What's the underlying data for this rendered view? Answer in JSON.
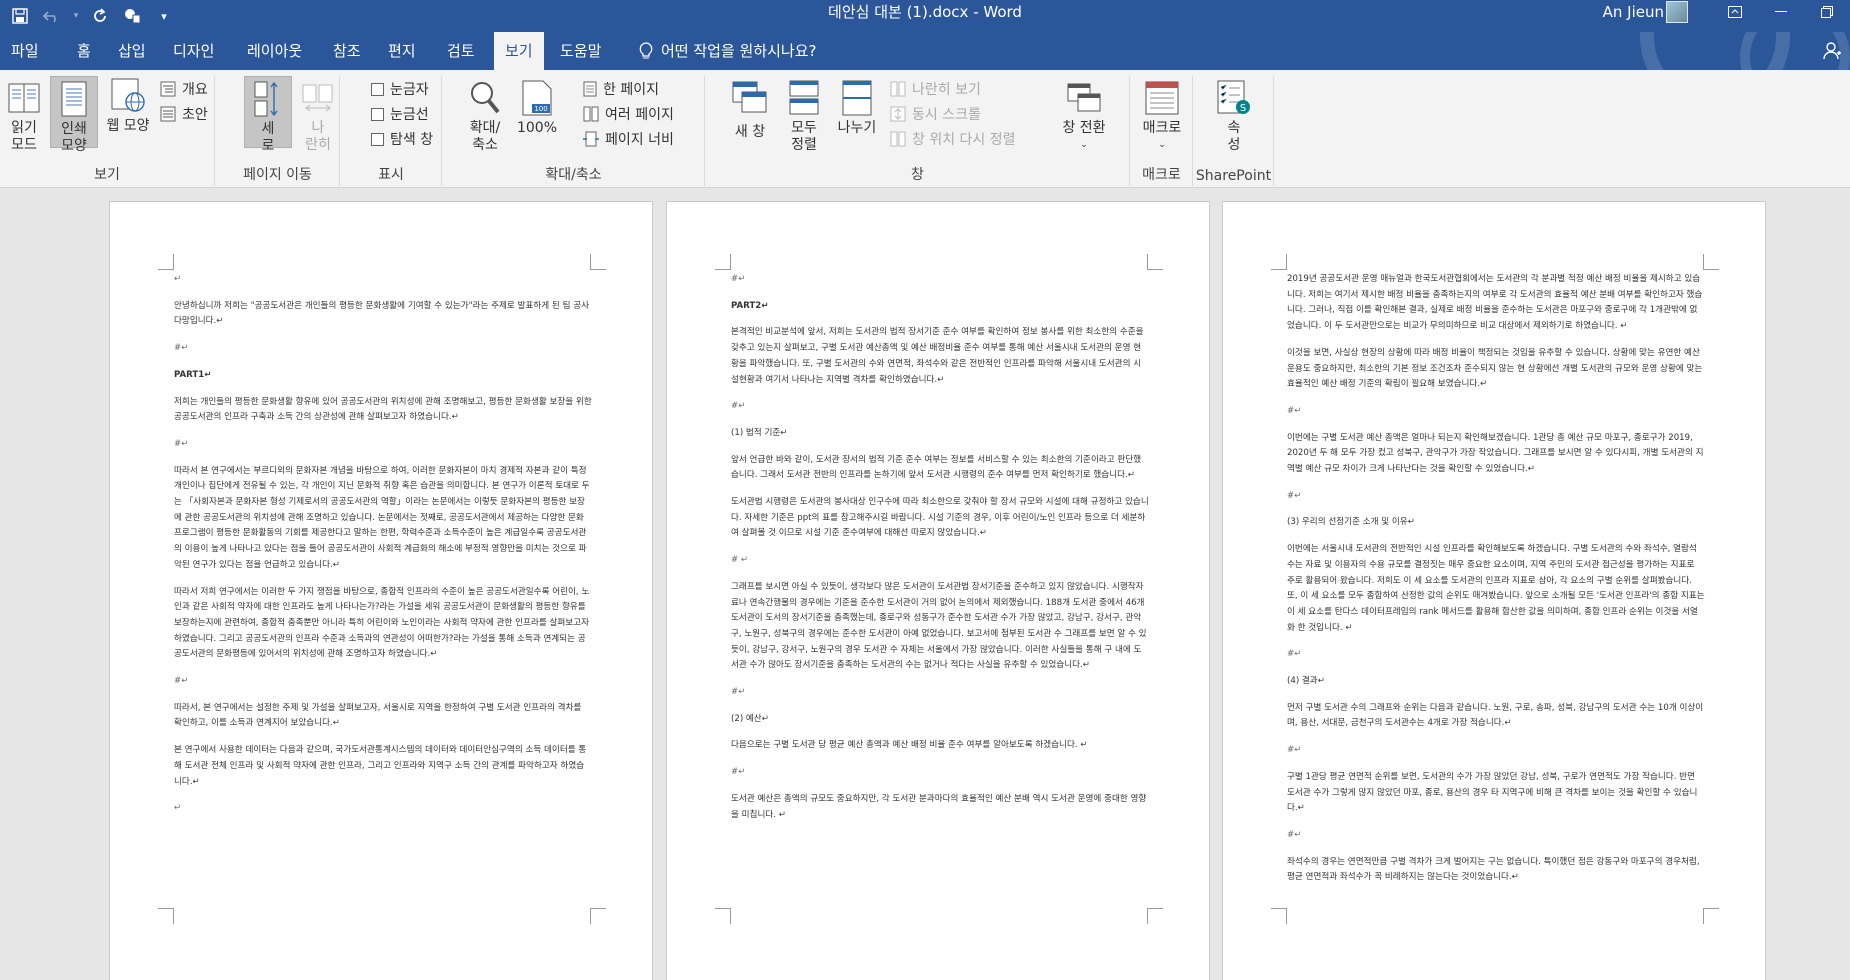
{
  "window": {
    "doc_title": "데안심 대본 (1).docx  -  Word",
    "user_name": "An Jieun",
    "qat": [
      {
        "icon": "save-icon"
      },
      {
        "icon": "undo-icon"
      },
      {
        "icon": "redo-icon"
      },
      {
        "icon": "touch-mode-icon"
      },
      {
        "icon": "customize-qat-icon"
      }
    ]
  },
  "tabs": [
    "파일",
    "홈",
    "삽입",
    "디자인",
    "레이아웃",
    "참조",
    "편지",
    "검토",
    "보기",
    "도움말"
  ],
  "active_tab": "보기",
  "tell_me": "어떤 작업을 원하시나요?",
  "ribbon": {
    "views": {
      "label": "보기",
      "read_mode": "읽기\n모드",
      "print_layout": "인쇄\n모양",
      "web_layout": "웹 모양",
      "outline": "개요",
      "draft": "초안"
    },
    "page_move": {
      "label": "페이지 이동",
      "vertical": "세\n로",
      "side_to_side": "나\n란히"
    },
    "show": {
      "label": "표시",
      "ruler": "눈금자",
      "gridlines": "눈금선",
      "nav_pane": "탐색 창"
    },
    "zoom": {
      "label": "확대/축소",
      "zoom": "확대/\n축소",
      "hundred": "100%",
      "one_page": "한 페이지",
      "multi_page": "여러 페이지",
      "page_width": "페이지 너비"
    },
    "window": {
      "label": "창",
      "new_window": "새 창",
      "arrange_all": "모두\n정렬",
      "split": "나누기",
      "side_by_side": "나란히 보기",
      "sync_scroll": "동시 스크롤",
      "reset_position": "창 위치 다시 정렬",
      "switch_windows": "창 전환"
    },
    "macros": {
      "label": "매크로",
      "macros": "매크로"
    },
    "sharepoint": {
      "label": "SharePoint",
      "properties": "속\n성"
    }
  },
  "pages": [
    {
      "paragraphs": [
        {
          "text": "↵",
          "kind": "mark"
        },
        {
          "text": " 안녕하십니까 저희는 \"공공도서관은 개인들의 평등한 문화생활에 기여할 수 있는가\"라는 주제로 발표하게 된 팀 공사다망입니다.↵",
          "kind": "para"
        },
        {
          "text": "#↵",
          "kind": "mark"
        },
        {
          "text": "PART1↵",
          "kind": "bold"
        },
        {
          "text": " 저희는 개인들의 평등한 문화생활 향유에 있어 공공도서관의 위치성에 관해 조명해보고, 평등한 문화생활 보장을 위한 공공도서관의 인프라 구축과 소득 간의 상관성에 관해 살펴보고자 하였습니다.↵",
          "kind": "para"
        },
        {
          "text": "#↵",
          "kind": "mark"
        },
        {
          "text": " 따라서 본 연구에서는 부르디외의 문화자본 개념을 바탕으로 하여, 이러한 문화자본이 마치 경제적 자본과 같이 특정 개인이나 집단에게 전유될 수 있는, 각 개인이 지닌 문화적 취향 혹은 습관을 의미합니다. 본 연구가 이론적 토대로 두는 「사회자본과 문화자본 형성 기제로서의 공공도서관의 역할」이라는 논문에서는 이렇듯 문화자본의 평등한 보장에 관한 공공도서관의 위치성에 관해 조명하고 있습니다. 논문에서는 젓째로, 공공도서관에서 제공하는 다양한 문화 프로그램이 평등한 문화활동의 기회를 제공한다고 말하는 한편, 학력수준과 소득수준이 높은 계급일수록 공공도서관의 이용이 높게 나타나고 있다는 점을 들어 공공도서관이 사회적 계급화의 해소에 부정적 영향만을 미치는 것으로 파악된 연구가 있다는 점을 언급하고 있습니다.↵",
          "kind": "para"
        },
        {
          "text": " 따라서 저희 연구에서는 이러한 두 가지 쟁점을 바탕으로, 종합적 인프라의 수준이 높은 공공도서관일수록 어린이, 노인과 같은 사회적 약자에 대한 인프라도 높게 나타나는가?라는 가설을 세워 공공도서관이 문화생활의 평등한 향유를 보장하는지에 관련하여, 종합적 충족뿐만 아니라 특히 어린이와 노인이라는 사회적 약자에 관한 인프라를 살펴보고자 하였습니다. 그리고 공공도서관의 인프라 수준과 소득과의 연관성이 어떠한가?라는 가설을 통해 소득과 연계되는 공공도서관의 문화평등에 있어서의 위치성에 관해 조명하고자 하였습니다.↵",
          "kind": "para"
        },
        {
          "text": "#↵",
          "kind": "mark"
        },
        {
          "text": " 따라서, 본 연구에서는 설정한 주제 및 가설을 살펴보고자, 서울시로 지역을 한정하여 구별 도서관 인프라의 격차를 확인하고, 이를 소득과 연계지어 보았습니다.↵",
          "kind": "para"
        },
        {
          "text": " 본 연구에서 사용한 데이터는 다음과 같으며, 국가도서관통계시스템의 데이터와 데이터안심구역의 소득 데이터를 통해 도서관 전체 인프라 및 사회적 약자에 관한 인프라, 그리고 인프라와 지역구 소득 간의 관계를 파악하고자 하였습니다.↵",
          "kind": "para"
        },
        {
          "text": "↵",
          "kind": "mark"
        }
      ]
    },
    {
      "paragraphs": [
        {
          "text": "#↵",
          "kind": "mark"
        },
        {
          "text": "PART2↵",
          "kind": "bold"
        },
        {
          "text": "본격적인 비교분석에 앞서, 저희는 도서관의 법적 장서기준 준수 여부를 확인하여 정보 봉사를 위한 최소한의 수준을 갖추고 있는지 살펴보고, 구별 도서관 예산총액 및 예산 배정비율 준수 여부를 통해 예산 서울시내 도서관의 운영 현황을 파악했습니다. 또, 구별 도서관의 수와 연면적, 좌석수와 같은 전반적인 인프라를 파악해 서울시내 도서관의 시설현황과 여기서 나타나는 지역별 격차를 확인하였습니다.↵",
          "kind": "para"
        },
        {
          "text": "#↵",
          "kind": "mark"
        },
        {
          "text": "(1) 법적 기준↵",
          "kind": "para"
        },
        {
          "text": "앞서 언급한 바와 같이, 도서관 장서의 법적 기준 준수 여부는 정보를 서비스할 수 있는 최소한의 기준이라고 판단했습니다. 그래서 도서관 전반의 인프라를 논하기에 앞서 도서관 시행령의 준수 여부를 먼저 확인하기로 했습니다.↵",
          "kind": "para"
        },
        {
          "text": "도서관법 시행령은 도서관의 봉사대상 인구수에 따라 최소한으로 갖춰야 할 장서 규모와 시설에 대해 규정하고 있습니다. 자세한 기준은 ppt의 표를 참고해주시길 바랍니다.  시설 기준의 경우, 이후 어린이/노인 인프라 등으로 더 세분하여 살펴볼 것 이므로 시설 기준 준수여부에 대해선 따로지 않았습니다.↵",
          "kind": "para"
        },
        {
          "text": "#  ↵",
          "kind": "mark"
        },
        {
          "text": "그래프를 보시면 아실 수 있듯이, 생각보다 많은 도서관이 도서관법 장서기준을 준수하고 있지 않았습니다. 시행작자료나 연속간행물의 경우에는 기준을 준수한 도서관이 거의 없어 논의에서 제외했습니다. 188개 도서관 중에서 46개 도서관이 도서의 장서기준을 충족했는데, 종로구와 성동구가 준수한 도서관 수가 가장 많았고, 강남구, 강서구, 관악구, 노원구, 성북구의 경우에는 준수한 도서관이 아예 없었습니다. 보고서에 첨부된 도서관 수 그래프를 보면 알 수 있듯이, 강남구, 강서구, 노원구의 경우 도서관 수 자체는 서울에서 가장 많았습니다. 이러한 사실들을 통해 구 내에 도서관 수가 많아도 장서기준을 충족하는 도서관의 수는 없거나 적다는 사실을 유추할 수 있었습니다.↵",
          "kind": "para"
        },
        {
          "text": "#↵",
          "kind": "mark"
        },
        {
          "text": "(2) 예산↵",
          "kind": "para"
        },
        {
          "text": "다음으로는 구별 도서관 당 평균 예산 총액과 예산 배정 비율 준수 여부를 알아보도록 하겠습니다. ↵",
          "kind": "para"
        },
        {
          "text": "#↵",
          "kind": "mark"
        },
        {
          "text": "도서관 예산은 총액의 규모도 중요하지만, 각 도서관 분과마다의 효율적인 예산 분배 역시 도서관 운영에 중대한 영향을 미칩니다. ↵",
          "kind": "para"
        }
      ]
    },
    {
      "paragraphs": [
        {
          "text": "2019년 공공도서관 운영 매뉴얼과 한국도서관협회에서는 도서관의 각 분과별 적정 예산 배정 비율을 제시하고 있습니다. 저희는 여기서 제시한 배정 비율을 충족하는지의 여부로 각 도서관의 효율적 예산 분배 여부를 확인하고자 했습니다. 그러나, 직접 이를 확인해본 결과, 실제로 배정 비율을 준수하는 도서관은 마포구와 중로구에 각 1개관밖에 없었습니다. 이 두 도서관만으로는 비교가 무의미하므로 비교 대상에서 제외하기로 하였습니다. ↵",
          "kind": "para"
        },
        {
          "text": "이것을 보면, 사실상 현장의 상황에 따라 배정 비율이 책정되는 것임을 유추할 수 있습니다. 상황에 맞는 유연한 예산 운용도 중요하지만, 최소한의 기본 정보 조건조차 준수되지 않는 현 상황에선 개별 도서관의 규모와 운영 상황에 맞는 효율적인 예산 배정 기준의 확립이 필요해 보였습니다.↵",
          "kind": "para"
        },
        {
          "text": "#↵",
          "kind": "mark"
        },
        {
          "text": "이번에는 구별 도서관 예산 총액은 얼마나 되는지 확인해보겠습니다. 1관당 총 예산 규모 마포구, 종로구가 2019, 2020년 두 해 모두 가장 컸고 성북구, 관악구가 가장 작았습니다. 그래프를 보시면 알 수 있다시피, 개별 도서관의 지역별 예산 규모 차이가 크게 나타난다는 것을 확인할 수 있었습니다.↵",
          "kind": "para"
        },
        {
          "text": "#↵",
          "kind": "mark"
        },
        {
          "text": "(3) 우리의 선정기준 소개 및 이유↵",
          "kind": "para"
        },
        {
          "text": "이번에는 서울시내 도서관의 전반적인 시설 인프라를 확인해보도록 하겠습니다.  구별 도서관의 수와 좌석수, 열람석 수는 자료 및 이용자의 수용 규모를 결정짓는 매우 중요한 요소이며, 지역 주민의 도서관 접근성을 평가하는 지표로 주로 활용되어 왔습니다. 저희도 이 세 요소를 도서관의 인프라 지표로 삼아, 각 요소의 구별 순위를 살펴봤습니다. 또, 이 세 요소를 모두 종합하여 산정한 값의 순위도 매겨봤습니다. 앞으로 소개될 모든 '도서관 인프라'의 종합 지표는 이 세 요소를 탄다스 데이터프레임의 rank 메서드를 활용해 합산한 값을 의미하며, 종합 인프라 순위는 이것을 서열화 한 것입니다. ↵",
          "kind": "para"
        },
        {
          "text": "#↵",
          "kind": "mark"
        },
        {
          "text": "(4) 결과↵",
          "kind": "para"
        },
        {
          "text": "먼저 구별 도서관 수의 그래프와 순위는 다음과 같습니다. 노원, 구로, 송파, 성북, 강남구의 도서관 수는 10개 이상이며, 용산, 서대문, 금천구의 도서관수는 4개로 가장 적습니다.↵",
          "kind": "para"
        },
        {
          "text": "#↵",
          "kind": "mark"
        },
        {
          "text": "구별 1관당 평균 연면적 순위를 보면, 도서관의 수가 가장 많았던 강남, 성북, 구로가 연면적도 가장 작습니다. 반면 도서관 수가 그렇게 많지 않았던 마포, 종로, 용산의 경우 타 지역구에 비해 큰 격차를 보이는 것을 확인할 수 있습니다.↵",
          "kind": "para"
        },
        {
          "text": "#↵",
          "kind": "mark"
        },
        {
          "text": "좌석수의 경우는 연면적만큼 구별 격차가 크게 벌어지는 구는 없습니다. 특이했던 점은 강동구와 마포구의 경우처럼, 평균 연면적과 좌석수가 꼭 비례하지는 않는다는 것이었습니다.↵",
          "kind": "para"
        }
      ]
    }
  ]
}
